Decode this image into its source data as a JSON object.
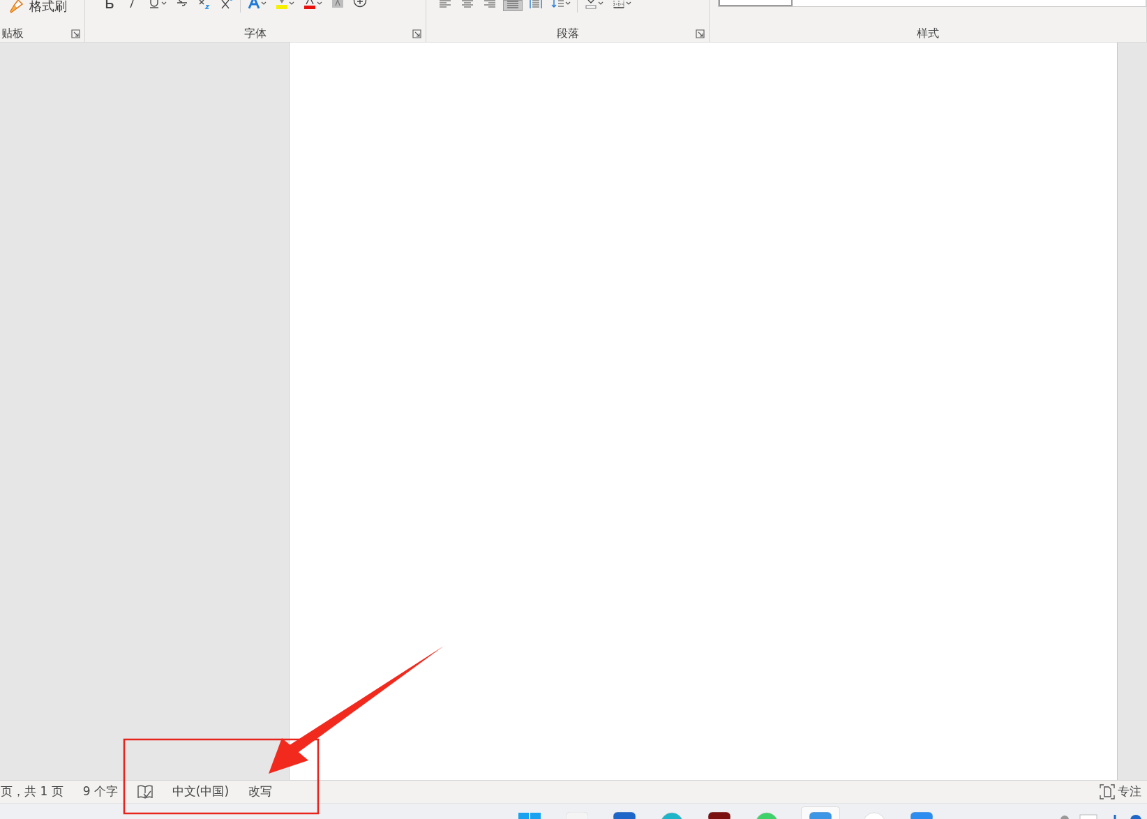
{
  "ribbon": {
    "groups": [
      {
        "label": "贴板",
        "launcher": true,
        "tools": [
          {
            "kind": "format-painter",
            "label": "格式刷"
          }
        ]
      },
      {
        "label": "字体",
        "launcher": true,
        "tools": [
          {
            "kind": "bold",
            "dropdown": false
          },
          {
            "kind": "italic",
            "dropdown": false
          },
          {
            "kind": "underline",
            "dropdown": true
          },
          {
            "kind": "strike",
            "dropdown": false
          },
          {
            "kind": "subscript",
            "dropdown": false
          },
          {
            "kind": "superscript",
            "dropdown": false
          },
          {
            "kind": "separator"
          },
          {
            "kind": "text-effect",
            "dropdown": true
          },
          {
            "kind": "highlight",
            "dropdown": true
          },
          {
            "kind": "font-color",
            "dropdown": true
          },
          {
            "kind": "shading",
            "dropdown": false
          },
          {
            "kind": "enclosed",
            "dropdown": false
          }
        ]
      },
      {
        "label": "段落",
        "launcher": true,
        "tools": [
          {
            "kind": "align-left",
            "selected": false,
            "dropdown": false
          },
          {
            "kind": "align-center",
            "selected": false,
            "dropdown": false
          },
          {
            "kind": "align-right",
            "selected": false,
            "dropdown": false
          },
          {
            "kind": "justify",
            "selected": true,
            "dropdown": false
          },
          {
            "kind": "distributed",
            "selected": false,
            "dropdown": false
          },
          {
            "kind": "line-spacing",
            "dropdown": true
          },
          {
            "kind": "separator"
          },
          {
            "kind": "fill",
            "dropdown": true
          },
          {
            "kind": "borders",
            "dropdown": true
          }
        ]
      },
      {
        "label": "样式",
        "launcher": false,
        "tools": [
          {
            "kind": "style-gallery"
          }
        ]
      }
    ]
  },
  "status_bar": {
    "left": [
      {
        "kind": "text",
        "label": "页，共 1 页"
      },
      {
        "kind": "text",
        "label": "9 个字"
      },
      {
        "kind": "proofing"
      },
      {
        "kind": "text",
        "label": "中文(中国)"
      },
      {
        "kind": "text",
        "label": "改写"
      }
    ],
    "right": [
      {
        "kind": "focus",
        "label": "专注"
      }
    ]
  },
  "taskbar": {
    "apps": [
      {
        "kind": "start",
        "selected": false
      },
      {
        "kind": "app",
        "color": "#f4f4f4",
        "selected": false
      },
      {
        "kind": "app",
        "color": "#1e66c8",
        "selected": false
      },
      {
        "kind": "round",
        "color": "#1fb5c9",
        "selected": false
      },
      {
        "kind": "app",
        "color": "#7a1010",
        "selected": false
      },
      {
        "kind": "round",
        "color": "#3fd16a",
        "selected": false
      },
      {
        "kind": "app",
        "color": "#3d95e6",
        "selected": true
      },
      {
        "kind": "round",
        "color": "#ffffff",
        "selected": false
      },
      {
        "kind": "app",
        "color": "#2d8cf0",
        "selected": false
      }
    ]
  },
  "annotations": [
    {
      "kind": "rectangle"
    },
    {
      "kind": "arrow"
    }
  ]
}
